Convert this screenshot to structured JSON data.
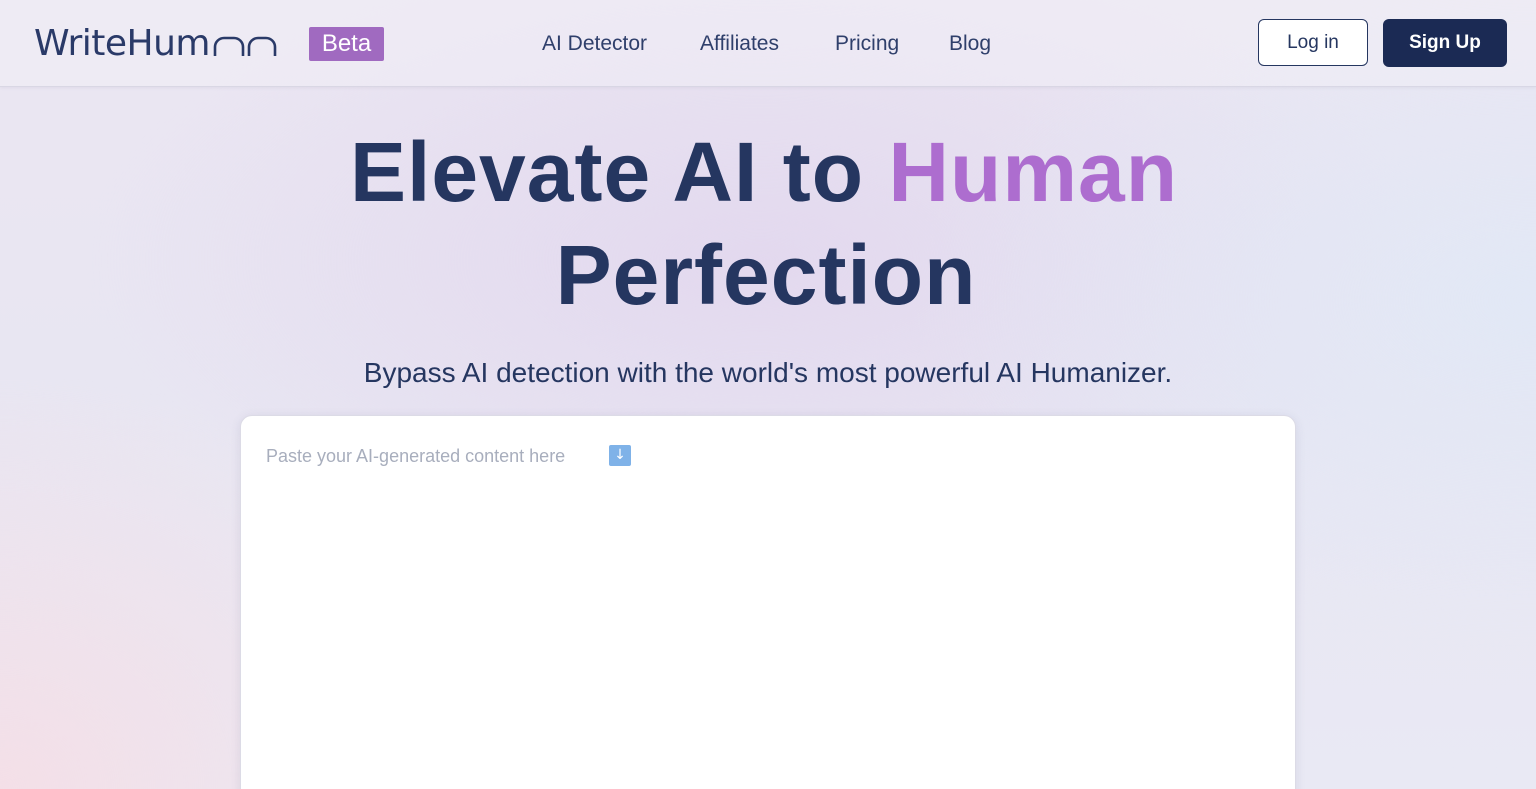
{
  "header": {
    "logo_text": "WriteHuman",
    "badge": "Beta",
    "nav": [
      {
        "label": "AI Detector"
      },
      {
        "label": "Affiliates"
      },
      {
        "label": "Pricing"
      },
      {
        "label": "Blog"
      }
    ],
    "login_label": "Log in",
    "signup_label": "Sign Up"
  },
  "hero": {
    "line1_prefix": "Elevate AI to ",
    "line1_accent": "Human",
    "line2": "Perfection",
    "subtitle": "Bypass AI detection with the world's most powerful AI Humanizer."
  },
  "editor": {
    "placeholder": "Paste your AI-generated content here",
    "arrow_icon": "down-arrow-icon",
    "arrow_glyph": "↓"
  },
  "colors": {
    "primary_navy": "#1b2a54",
    "text_navy": "#253660",
    "accent_purple": "#ad6dcf",
    "badge_purple": "#a06ac0",
    "arrow_blue": "#7fb2e8"
  }
}
